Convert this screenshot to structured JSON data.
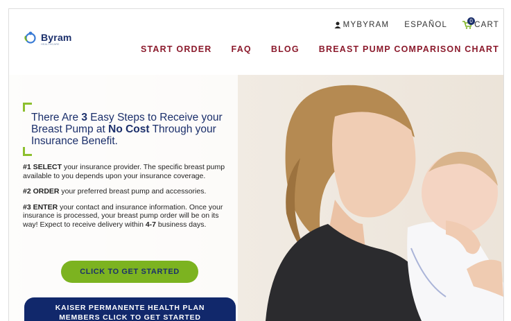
{
  "header": {
    "logo_text": "Byram",
    "logo_sub": "HEALTHCARE",
    "utility": {
      "account_label": "MYBYRAM",
      "language_label": "ESPAÑOL",
      "cart_label": "CART",
      "cart_count": "0"
    },
    "nav": [
      "START ORDER",
      "FAQ",
      "BLOG",
      "BREAST PUMP COMPARISON CHART"
    ]
  },
  "hero": {
    "headline": {
      "p1": "There Are ",
      "n": "3",
      "p2": " Easy Steps to Receive your Breast Pump at ",
      "nc": "No Cost",
      "p3": " Through your Insurance Benefit."
    },
    "steps": [
      {
        "lead": "#1 SELECT",
        "text": " your insurance provider. The specific breast pump available to you depends upon your insurance coverage."
      },
      {
        "lead": "#2 ORDER",
        "text": " your preferred breast pump and accessories."
      },
      {
        "lead": "#3 ENTER",
        "text": " your contact and insurance information. Once your insurance is processed, your breast pump order will be on its way! Expect to receive delivery within ",
        "days": "4-7",
        "tail": " business days."
      }
    ],
    "cta_primary": "CLICK TO GET STARTED",
    "cta_kaiser_l1": "KAISER PERMANENTE HEALTH PLAN",
    "cta_kaiser_l2": "MEMBERS CLICK TO GET STARTED"
  },
  "colors": {
    "brand_navy": "#1b2f6b",
    "nav_red": "#8b1a2c",
    "accent_green": "#7cb320"
  }
}
